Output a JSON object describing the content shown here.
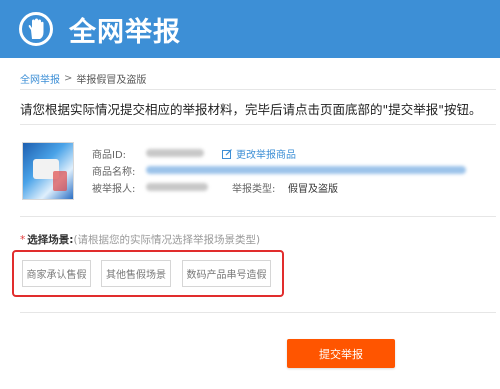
{
  "header": {
    "title": "全网举报",
    "bg_color": "#3d8fd6",
    "icon": "hand-stop-icon"
  },
  "breadcrumb": {
    "root": "全网举报",
    "separator": ">",
    "current": "举报假冒及盗版"
  },
  "instruction": "请您根据实际情况提交相应的举报材料，完毕后请点击页面底部的\"提交举报\"按钮。",
  "product": {
    "id_label": "商品ID:",
    "name_label": "商品名称:",
    "reported_label": "被举报人:",
    "report_type_label": "举报类型:",
    "report_type_value": "假冒及盗版",
    "edit_link": "更改举报商品"
  },
  "scene": {
    "required_mark": "*",
    "label": "选择场景:",
    "hint": "(请根据您的实际情况选择举报场景类型)",
    "options": [
      "商家承认售假",
      "其他售假场景",
      "数码产品串号造假"
    ],
    "highlight_color": "#e12d2d"
  },
  "submit_label": "提交举报",
  "submit_color": "#ff5500"
}
